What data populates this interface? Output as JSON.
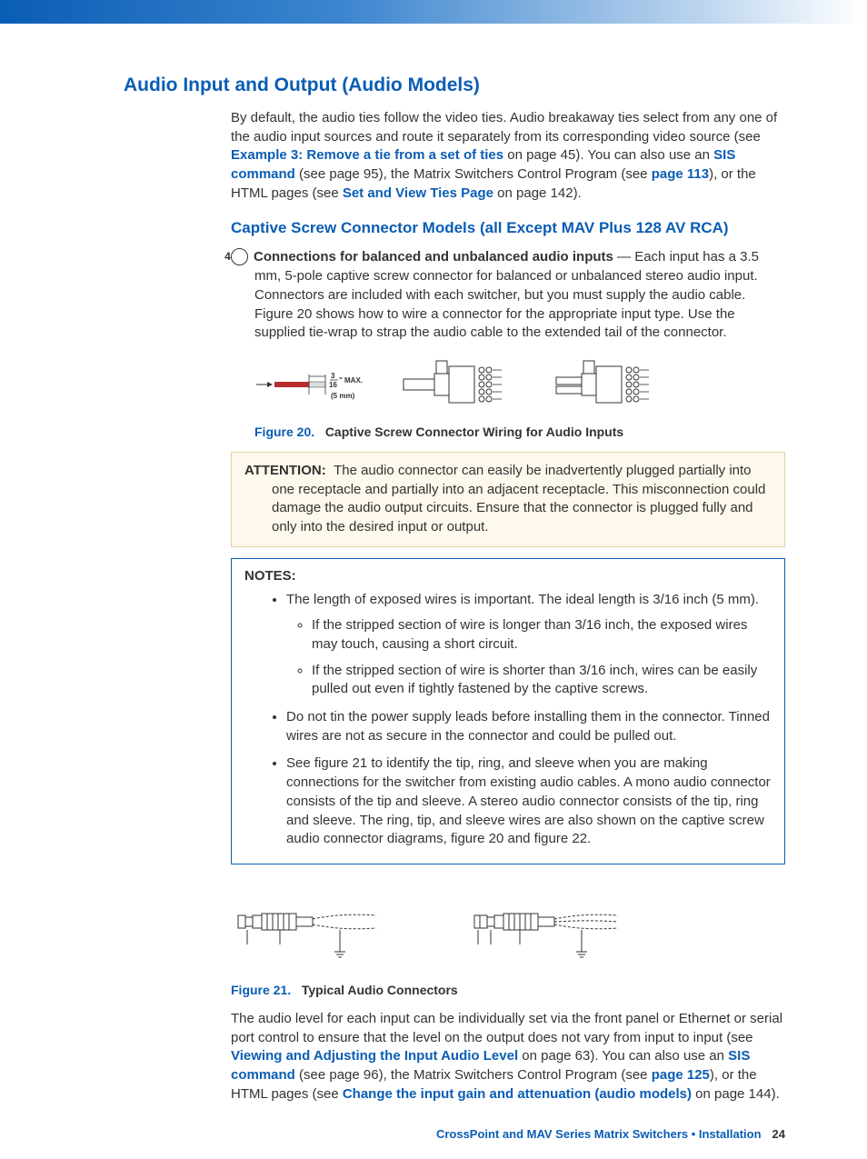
{
  "h1": "Audio Input and Output (Audio Models)",
  "p1": {
    "t1": "By default, the audio ties follow the video ties. Audio breakaway ties select from any one of the audio input sources and route it separately from its corresponding video source (see ",
    "l1": "Example 3: Remove a tie from a set of ties",
    "t2": " on page 45). You can also use an ",
    "l2": "SIS command",
    "t3": " (see page 95), the Matrix Switchers Control Program (see ",
    "l3": "page 113",
    "t4": "), or the HTML pages (see ",
    "l4": "Set and View Ties Page",
    "t5": " on page 142)."
  },
  "h2": "Captive Screw Connector Models (all Except MAV Plus 128 AV RCA)",
  "num4": {
    "circle": "4",
    "bold": "Connections for balanced and unbalanced audio inputs",
    "t1": " — Each input has a 3.5 mm, 5-pole captive screw connector for balanced or unbalanced stereo audio input. Connectors are included with each switcher, but you must supply the audio cable. Figure 20 shows how to wire a connector for the appropriate input type. Use the supplied tie-wrap to strap the audio cable to the extended tail of the connector."
  },
  "strip": {
    "frac_top": "3",
    "frac_bot": "16",
    "unit": "\" MAX.",
    "mm": "(5 mm)"
  },
  "fig20": {
    "label": "Figure 20.",
    "title": "Captive Screw Connector Wiring for Audio Inputs"
  },
  "attention": {
    "label": "ATTENTION:",
    "lead": "The audio connector can easily be inadvertently plugged partially into ",
    "body": "one receptacle and partially into an adjacent receptacle. This misconnection could damage the audio output circuits. Ensure that the connector is plugged fully and only into the desired input or output."
  },
  "notes": {
    "label": "NOTES:",
    "n1": "The length of exposed wires is important. The ideal length is 3/16 inch (5 mm).",
    "n1a": "If the stripped section of wire is longer than 3/16 inch, the exposed wires may touch, causing a short circuit.",
    "n1b": "If the stripped section of wire is shorter than 3/16 inch, wires can be easily pulled out even if tightly fastened by the captive screws.",
    "n2": "Do not tin the power supply leads before installing them in the connector. Tinned wires are not as secure in the connector and could be pulled out.",
    "n3": "See figure 21 to identify the tip, ring, and sleeve when you are making connections for the switcher from existing audio cables. A mono audio connector consists of the tip and sleeve. A stereo audio connector consists of the tip, ring and sleeve. The ring, tip, and sleeve wires are also shown on the captive screw audio connector diagrams, figure 20 and figure 22."
  },
  "fig21": {
    "label": "Figure 21.",
    "title": "Typical Audio Connectors"
  },
  "p2": {
    "t1": "The audio level for each input can be individually set via the front panel or Ethernet or serial port control to ensure that the level on the output does not vary from input to input (see ",
    "l1": "Viewing and Adjusting the Input Audio Level",
    "t2": " on page 63). You can also use an ",
    "l2": "SIS command",
    "t3": " (see page 96), the Matrix Switchers Control Program (see ",
    "l3": "page 125",
    "t4": "), or the HTML pages (see ",
    "l4": "Change the input gain and attenuation (audio models)",
    "t5": " on page 144)."
  },
  "footer": {
    "text": "CrossPoint and MAV Series Matrix Switchers • Installation",
    "page": "24"
  }
}
